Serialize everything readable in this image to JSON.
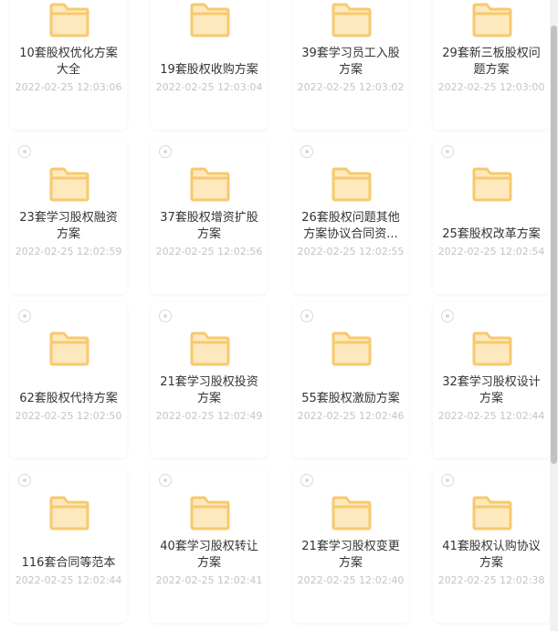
{
  "colors": {
    "folder": "#f7c96e",
    "folder_fill": "#fde9bd"
  },
  "items": [
    {
      "name": "10套股权优化方案大全",
      "date": "2022-02-25 12:03:06"
    },
    {
      "name": "19套股权收购方案",
      "date": "2022-02-25 12:03:04"
    },
    {
      "name": "39套学习员工入股方案",
      "date": "2022-02-25 12:03:02"
    },
    {
      "name": "29套新三板股权问题方案",
      "date": "2022-02-25 12:03:00"
    },
    {
      "name": "23套学习股权融资方案",
      "date": "2022-02-25 12:02:59"
    },
    {
      "name": "37套股权增资扩股方案",
      "date": "2022-02-25 12:02:56"
    },
    {
      "name": "26套股权问题其他方案协议合同资...",
      "date": "2022-02-25 12:02:55"
    },
    {
      "name": "25套股权改革方案",
      "date": "2022-02-25 12:02:54"
    },
    {
      "name": "62套股权代持方案",
      "date": "2022-02-25 12:02:50"
    },
    {
      "name": "21套学习股权投资方案",
      "date": "2022-02-25 12:02:49"
    },
    {
      "name": "55套股权激励方案",
      "date": "2022-02-25 12:02:46"
    },
    {
      "name": "32套学习股权设计方案",
      "date": "2022-02-25 12:02:44"
    },
    {
      "name": "116套合同等范本",
      "date": "2022-02-25 12:02:44"
    },
    {
      "name": "40套学习股权转让方案",
      "date": "2022-02-25 12:02:41"
    },
    {
      "name": "21套学习股权变更方案",
      "date": "2022-02-25 12:02:40"
    },
    {
      "name": "41套股权认购协议方案",
      "date": "2022-02-25 12:02:38"
    }
  ]
}
